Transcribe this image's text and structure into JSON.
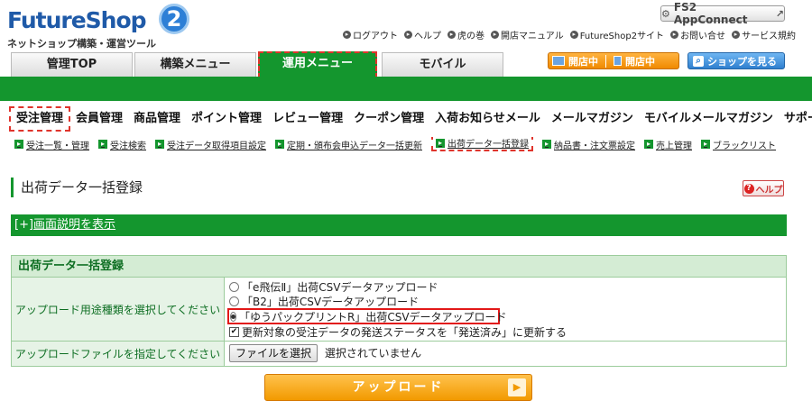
{
  "brand": {
    "logo_text": "FutureShop",
    "logo_badge": "2",
    "logo_sub": "ネットショップ構築・運営ツール",
    "accent_color": "#14962e",
    "highlight_color": "#e0342c"
  },
  "appconnect": {
    "label": "FS2 AppConnect",
    "icon": "appconnect-icon",
    "ext_icon": "external-link-icon"
  },
  "top_links": [
    "ログアウト",
    "ヘルプ",
    "虎の巻",
    "開店マニュアル",
    "FutureShop2サイト",
    "お問い合せ",
    "サービス規約"
  ],
  "main_tabs": [
    "管理TOP",
    "構築メニュー",
    "運用メニュー",
    "モバイル"
  ],
  "status": {
    "open_pc": "開店中",
    "open_mobile": "開店中"
  },
  "shop_button": "ショップを見る",
  "submenu": [
    "受注管理",
    "会員管理",
    "商品管理",
    "ポイント管理",
    "レビュー管理",
    "クーポン管理",
    "入荷お知らせメール",
    "メールマガジン",
    "モバイルメールマガジン",
    "サポート"
  ],
  "subsubmenu": [
    "受注一覧・管理",
    "受注検索",
    "受注データ取得項目設定",
    "定期・頒布会申込データ一括更新",
    "出荷データ一括登録",
    "納品書・注文票設定",
    "売上管理",
    "ブラックリスト"
  ],
  "page": {
    "title": "出荷データ一括登録",
    "help_label": "ヘルプ",
    "explain_toggle": "[+]",
    "explain_link": "画面説明を表示"
  },
  "form": {
    "heading": "出荷データ一括登録",
    "upload_type_label": "アップロード用途種類を選択してください",
    "options": [
      "「e飛伝Ⅱ」出荷CSVデータアップロード",
      "「B2」出荷CSVデータアップロード",
      "「ゆうパックプリントR」出荷CSVデータアップロード"
    ],
    "selected_option": 2,
    "update_checkbox_label": "更新対象の受注データの発送ステータスを「発送済み」に更新する",
    "update_checked": true,
    "file_label": "アップロードファイルを指定してください",
    "file_button": "ファイルを選択",
    "file_status": "選択されていません"
  },
  "upload_button": "アップロード"
}
